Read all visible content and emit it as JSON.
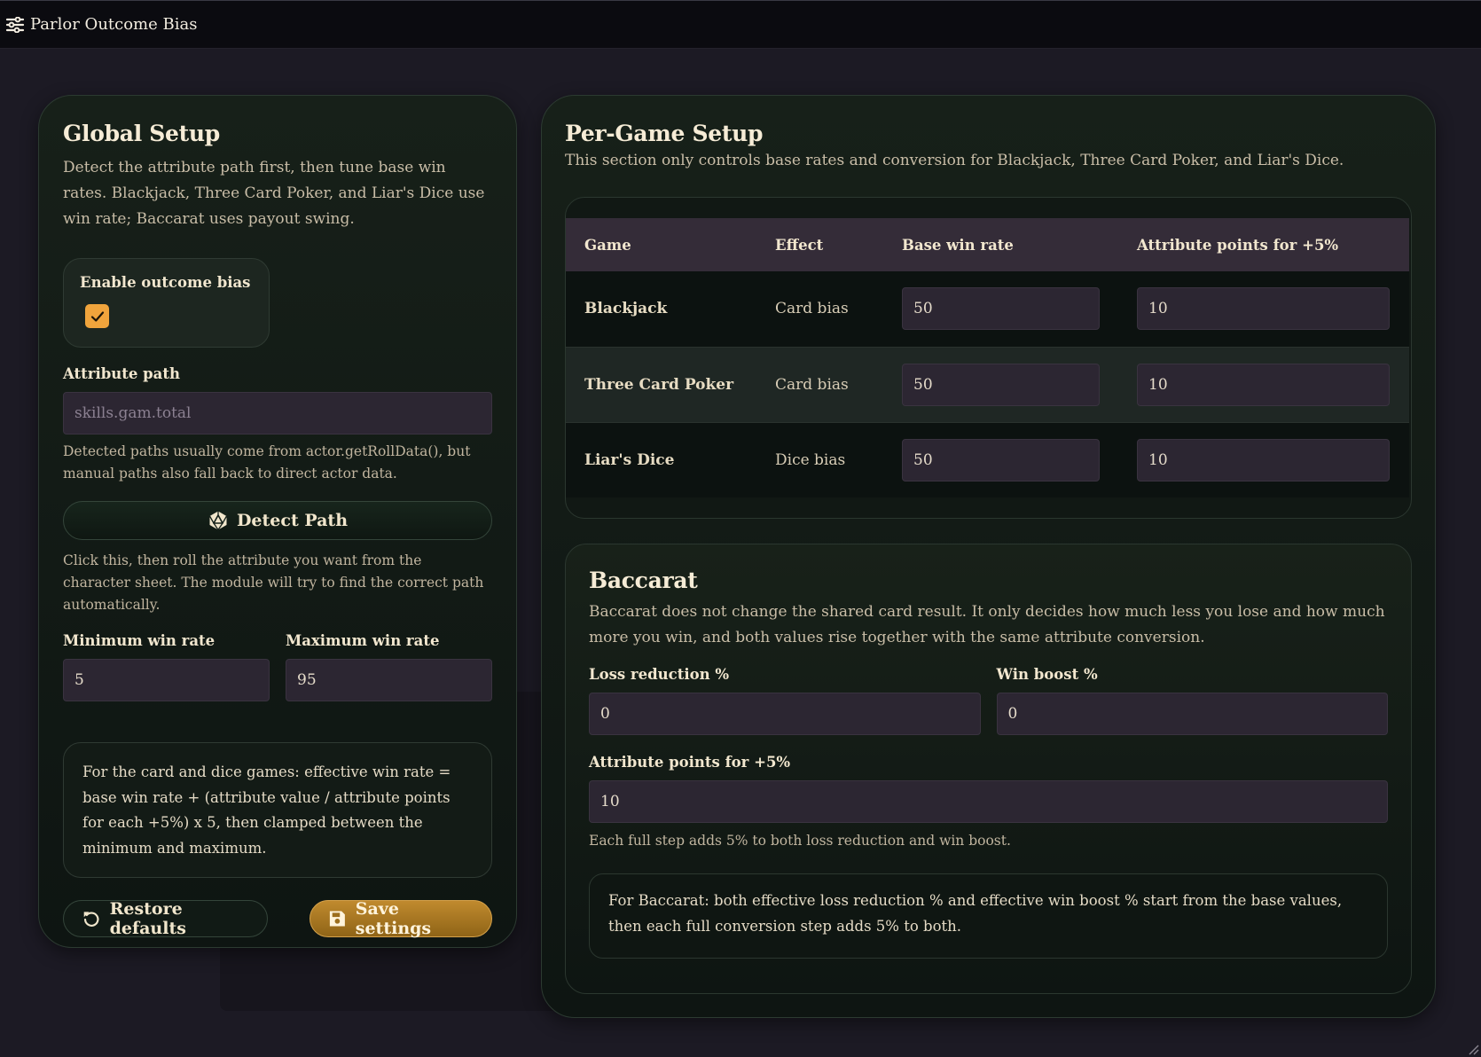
{
  "window": {
    "title": "Parlor Outcome Bias"
  },
  "global": {
    "title": "Global Setup",
    "description": "Detect the attribute path first, then tune base win rates. Blackjack, Three Card Poker, and Liar's Dice use win rate; Baccarat uses payout swing.",
    "enable_label": "Enable outcome bias",
    "enabled": true,
    "attribute_path_label": "Attribute path",
    "attribute_path_placeholder": "skills.gam.total",
    "attribute_path_hint": "Detected paths usually come from actor.getRollData(), but manual paths also fall back to direct actor data.",
    "detect_button": "Detect Path",
    "detect_hint": "Click this, then roll the attribute you want from the character sheet. The module will try to find the correct path automatically.",
    "min_label": "Minimum win rate",
    "min_value": "5",
    "max_label": "Maximum win rate",
    "max_value": "95",
    "formula": "For the card and dice games: effective win rate = base win rate + (attribute value / attribute points for each +5%) x 5, then clamped between the minimum and maximum.",
    "restore_button": "Restore defaults",
    "save_button": "Save settings"
  },
  "per_game": {
    "title": "Per-Game Setup",
    "description": "This section only controls base rates and conversion for Blackjack, Three Card Poker, and Liar's Dice.",
    "columns": [
      "Game",
      "Effect",
      "Base win rate",
      "Attribute points for +5%"
    ],
    "rows": [
      {
        "game": "Blackjack",
        "effect": "Card bias",
        "base": "50",
        "points": "10"
      },
      {
        "game": "Three Card Poker",
        "effect": "Card bias",
        "base": "50",
        "points": "10"
      },
      {
        "game": "Liar's Dice",
        "effect": "Dice bias",
        "base": "50",
        "points": "10"
      }
    ]
  },
  "baccarat": {
    "title": "Baccarat",
    "description": "Baccarat does not change the shared card result. It only decides how much less you lose and how much more you win, and both values rise together with the same attribute conversion.",
    "loss_label": "Loss reduction %",
    "loss_value": "0",
    "win_label": "Win boost %",
    "win_value": "0",
    "points_label": "Attribute points for +5%",
    "points_value": "10",
    "points_hint": "Each full step adds 5% to both loss reduction and win boost.",
    "formula": "For Baccarat: both effective loss reduction % and effective win boost % start from the base values, then each full conversion step adds 5% to both."
  },
  "colors": {
    "accent": "#f0a43c",
    "save_button": "#b07c25",
    "panel_bg": "#141c17"
  },
  "icons": {
    "title": "sliders-icon",
    "detect": "d20-icon",
    "restore": "undo-icon",
    "save": "floppy-disk-icon",
    "check": "checkmark-icon"
  }
}
